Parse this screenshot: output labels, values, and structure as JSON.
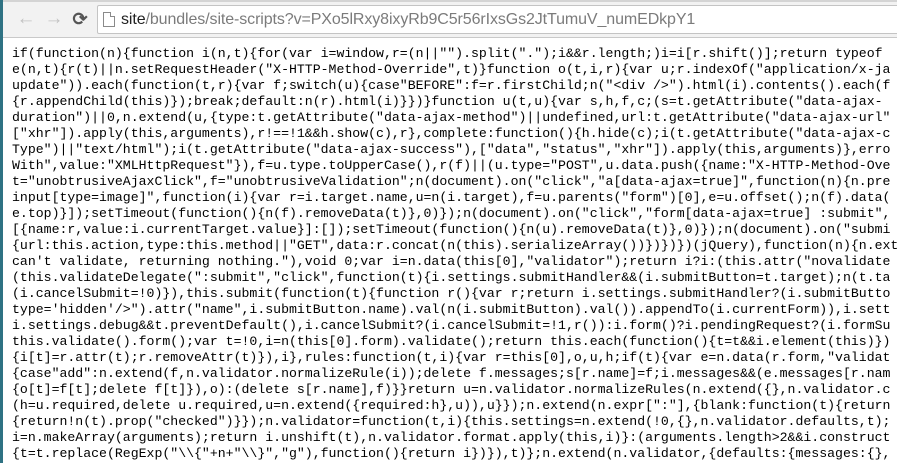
{
  "browser": {
    "back_icon": "arrow-left-icon",
    "forward_icon": "arrow-right-icon",
    "reload_icon": "reload-icon",
    "page_icon": "document-icon",
    "url_host": "site",
    "url_path": "/bundles/site-scripts?v=PXo5lRxy8ixyRb9C5r56rIxsGs2JtTumuV_numEDkpY1"
  },
  "code": {
    "lines": [
      "if(function(n){function i(n,t){for(var i=window,r=(n||\"\").split(\".\");i&&r.length;)i=i[r.shift()];return typeof",
      "e(n,t){r(t)||n.setRequestHeader(\"X-HTTP-Method-Override\",t)}function o(t,i,r){var u;r.indexOf(\"application/x-ja",
      "update\")).each(function(t,r){var f;switch(u){case\"BEFORE\":f=r.firstChild;n(\"<div />\").html(i).contents().each(f",
      "{r.appendChild(this)});break;default:n(r).html(i)}})}function u(t,u){var s,h,f,c;(s=t.getAttribute(\"data-ajax-",
      "duration\")||0,n.extend(u,{type:t.getAttribute(\"data-ajax-method\")||undefined,url:t.getAttribute(\"data-ajax-url\"",
      "[\"xhr\"]).apply(this,arguments),r!==!1&&h.show(c),r},complete:function(){h.hide(c);i(t.getAttribute(\"data-ajax-c",
      "Type\")||\"text/html\");i(t.getAttribute(\"data-ajax-success\"),[\"data\",\"status\",\"xhr\"]).apply(this,arguments)},erro",
      "With\",value:\"XMLHttpRequest\"}),f=u.type.toUpperCase(),r(f)||(u.type=\"POST\",u.data.push({name:\"X-HTTP-Method-Ove",
      "t=\"unobtrusiveAjaxClick\",f=\"unobtrusiveValidation\";n(document).on(\"click\",\"a[data-ajax=true]\",function(n){n.pre",
      "input[type=image]\",function(i){var r=i.target.name,u=n(i.target),f=u.parents(\"form\")[0],e=u.offset();n(f).data(",
      "e.top)}]);setTimeout(function(){n(f).removeData(t)},0)});n(document).on(\"click\",\"form[data-ajax=true] :submit\",",
      "[{name:r,value:i.currentTarget.value}]:[]);setTimeout(function(){n(u).removeData(t)},0)});n(document).on(\"submi",
      "{url:this.action,type:this.method||\"GET\",data:r.concat(n(this).serializeArray())})})})(jQuery),function(n){n.ext",
      "can't validate, returning nothing.\"),void 0;var i=n.data(this[0],\"validator\");return i?i:(this.attr(\"novalidate",
      "(this.validateDelegate(\":submit\",\"click\",function(t){i.settings.submitHandler&&(i.submitButton=t.target);n(t.ta",
      "(i.cancelSubmit=!0)}),this.submit(function(t){function r(){var r;return i.settings.submitHandler?(i.submitButto",
      "type='hidden'/>\").attr(\"name\",i.submitButton.name).val(n(i.submitButton).val()).appendTo(i.currentForm)),i.sett",
      "i.settings.debug&&t.preventDefault(),i.cancelSubmit?(i.cancelSubmit=!1,r()):i.form()?i.pendingRequest?(i.formSu",
      "this.validate().form();var t=!0,i=n(this[0].form).validate();return this.each(function(){t=t&&i.element(this)})",
      "{i[t]=r.attr(t);r.removeAttr(t)}),i},rules:function(t,i){var r=this[0],o,u,h;if(t){var e=n.data(r.form,\"validat",
      "{case\"add\":n.extend(f,n.validator.normalizeRule(i));delete f.messages;s[r.name]=f;i.messages&&(e.messages[r.nam",
      "{o[t]=f[t];delete f[t]}),o):(delete s[r.name],f)}}return u=n.validator.normalizeRules(n.extend({},n.validator.c",
      "(h=u.required,delete u.required,u=n.extend({required:h},u)),u}});n.extend(n.expr[\":\"],{blank:function(t){return",
      "{return!n(t).prop(\"checked\")}});n.validator=function(t,i){this.settings=n.extend(!0,{},n.validator.defaults,t);",
      "i=n.makeArray(arguments);return i.unshift(t),n.validator.format.apply(this,i)}:(arguments.length>2&&i.construct",
      "{t=t.replace(RegExp(\"\\\\{\"+n+\"\\\\}\",\"g\"),function(){return i})}),t)};n.extend(n.validator,{defaults:{messages:{},"
    ]
  }
}
